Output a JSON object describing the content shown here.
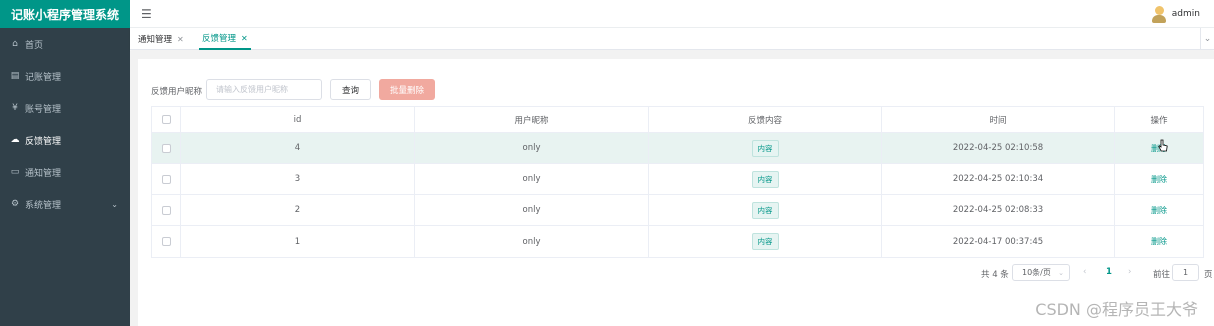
{
  "app": {
    "title": "记账小程序管理系统"
  },
  "sidebar": {
    "items": [
      {
        "label": "首页",
        "icon": "home-icon"
      },
      {
        "label": "记账管理",
        "icon": "document-icon"
      },
      {
        "label": "账号管理",
        "icon": "currency-icon"
      },
      {
        "label": "反馈管理",
        "icon": "feedback-icon",
        "active": true
      },
      {
        "label": "通知管理",
        "icon": "notice-icon"
      },
      {
        "label": "系统管理",
        "icon": "settings-icon",
        "has_submenu": true
      }
    ]
  },
  "header": {
    "user": "admin"
  },
  "tabs": [
    {
      "label": "通知管理"
    },
    {
      "label": "反馈管理",
      "active": true
    }
  ],
  "search": {
    "label": "反馈用户昵称",
    "placeholder": "请输入反馈用户昵称",
    "query_button": "查询",
    "batch_delete_button": "批量删除"
  },
  "table": {
    "columns": [
      "id",
      "用户昵称",
      "反馈内容",
      "时间",
      "操作"
    ],
    "rows": [
      {
        "id": "4",
        "nickname": "only",
        "content": "内容",
        "time": "2022-04-25 02:10:58",
        "action": "删除"
      },
      {
        "id": "3",
        "nickname": "only",
        "content": "内容",
        "time": "2022-04-25 02:10:34",
        "action": "删除"
      },
      {
        "id": "2",
        "nickname": "only",
        "content": "内容",
        "time": "2022-04-25 02:08:33",
        "action": "删除"
      },
      {
        "id": "1",
        "nickname": "only",
        "content": "内容",
        "time": "2022-04-17 00:37:45",
        "action": "删除"
      }
    ]
  },
  "pagination": {
    "total": "共 4 条",
    "page_size": "10条/页",
    "current_page": "1",
    "goto_label": "前往",
    "goto_value": "1",
    "page_suffix": "页"
  },
  "watermark": "CSDN @程序员王大爷",
  "colors": {
    "brand": "#009688",
    "sidebar": "#304049",
    "danger_light": "#f1a99f"
  }
}
